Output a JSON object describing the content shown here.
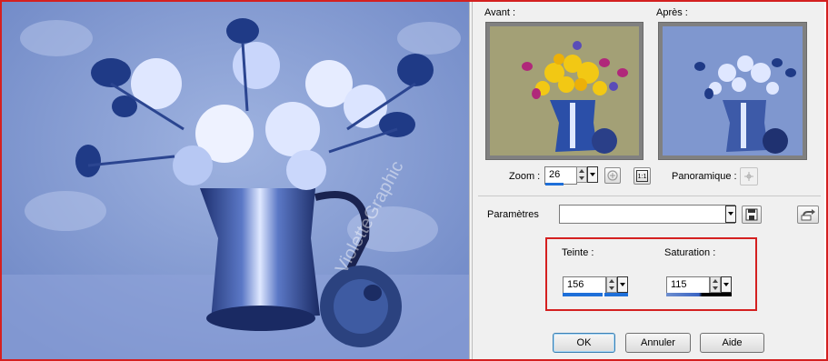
{
  "photo": {
    "description_hidden": "",
    "watermark": "VioletteGraphic",
    "tint_color": "#8aa3d8"
  },
  "before": {
    "label": "Avant :"
  },
  "after": {
    "label": "Après :"
  },
  "zoom": {
    "label": "Zoom :",
    "value": "26",
    "one_to_one": "1:1",
    "level": 0.26
  },
  "pan": {
    "label": "Panoramique :"
  },
  "params": {
    "label": "Paramètres",
    "value": ""
  },
  "hue": {
    "label": "Teinte :",
    "value": "156",
    "level": 0.61
  },
  "saturation": {
    "label": "Saturation :",
    "value": "115",
    "level": 0.45
  },
  "buttons": {
    "ok": "OK",
    "cancel": "Annuler",
    "help": "Aide"
  },
  "colors": {
    "highlight": "#d42020",
    "accent": "#1e6fd9"
  }
}
